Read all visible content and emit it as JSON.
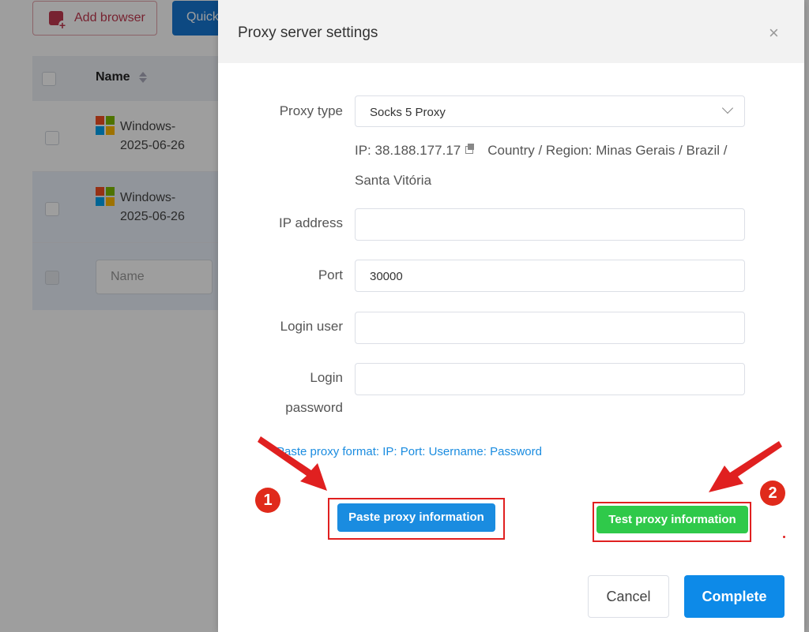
{
  "background": {
    "add_browser_label": "Add browser",
    "quick_label": "Quick",
    "table": {
      "name_header": "Name",
      "rows": [
        {
          "name": "Windows-2025-06-26"
        },
        {
          "name": "Windows-2025-06-26"
        }
      ],
      "name_placeholder": "Name"
    }
  },
  "modal": {
    "title": "Proxy server settings",
    "close": "×",
    "fields": {
      "proxy_type_label": "Proxy type",
      "proxy_type_value": "Socks 5 Proxy",
      "ip_line": "IP: 38.188.177.17",
      "region_line": "Country / Region: Minas Gerais / Brazil / Santa Vitória",
      "ip_address_label": "IP address",
      "ip_address_value": "",
      "port_label": "Port",
      "port_value": "30000",
      "login_user_label": "Login user",
      "login_user_value": "",
      "login_password_label": "Login password",
      "login_password_value": ""
    },
    "paste_hint": "Paste proxy format: IP: Port: Username: Password",
    "paste_button": "Paste proxy information",
    "test_button": "Test proxy information",
    "cancel_button": "Cancel",
    "complete_button": "Complete"
  },
  "annotations": {
    "badge_1": "1",
    "badge_2": "2",
    "color": "#e02020"
  }
}
